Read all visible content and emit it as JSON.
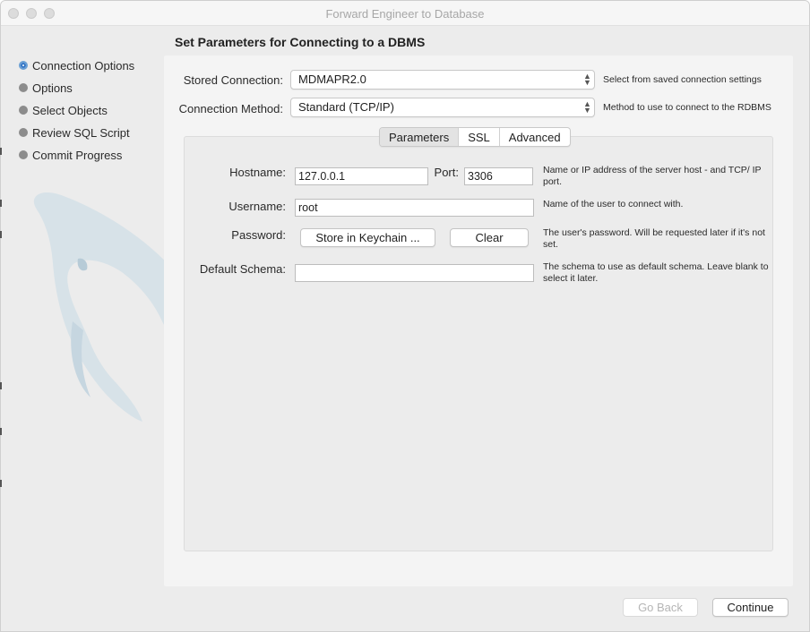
{
  "window": {
    "title": "Forward Engineer to Database"
  },
  "sidebar": {
    "items": [
      {
        "label": "Connection Options",
        "active": true
      },
      {
        "label": "Options",
        "active": false
      },
      {
        "label": "Select Objects",
        "active": false
      },
      {
        "label": "Review SQL Script",
        "active": false
      },
      {
        "label": "Commit Progress",
        "active": false
      }
    ]
  },
  "page": {
    "title": "Set Parameters for Connecting to a DBMS"
  },
  "stored_connection": {
    "label": "Stored Connection:",
    "value": "MDMAPR2.0",
    "hint": "Select from saved connection settings"
  },
  "connection_method": {
    "label": "Connection Method:",
    "value": "Standard (TCP/IP)",
    "hint": "Method to use to connect to the RDBMS"
  },
  "tabs": [
    {
      "label": "Parameters",
      "active": true
    },
    {
      "label": "SSL",
      "active": false
    },
    {
      "label": "Advanced",
      "active": false
    }
  ],
  "params": {
    "hostname_label": "Hostname:",
    "hostname_value": "127.0.0.1",
    "port_label": "Port:",
    "port_value": "3306",
    "hostname_hint": "Name or IP address of the server host - and TCP/ IP port.",
    "username_label": "Username:",
    "username_value": "root",
    "username_hint": "Name of the user to connect with.",
    "password_label": "Password:",
    "store_keychain_label": "Store in Keychain ...",
    "clear_label": "Clear",
    "password_hint": "The user's password. Will be requested later if it's not set.",
    "schema_label": "Default Schema:",
    "schema_value": "",
    "schema_hint": "The schema to use as default schema. Leave blank to select it later."
  },
  "footer": {
    "go_back_label": "Go Back",
    "continue_label": "Continue"
  },
  "colors": {
    "accent": "#2f73c4",
    "panel": "#f4f4f4",
    "window": "#ececec"
  }
}
